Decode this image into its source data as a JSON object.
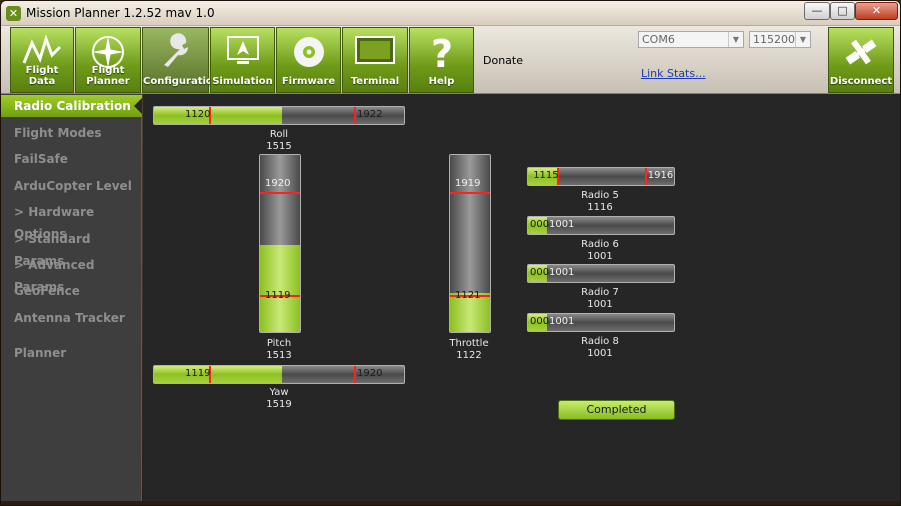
{
  "window": {
    "title": "Mission Planner 1.2.52 mav 1.0"
  },
  "toolbar": {
    "buttons": [
      {
        "label": "Flight Data",
        "icon": "flight-data-icon"
      },
      {
        "label": "Flight Planner",
        "icon": "compass-icon"
      },
      {
        "label": "Configuration",
        "icon": "wrench-icon"
      },
      {
        "label": "Simulation",
        "icon": "simulation-icon"
      },
      {
        "label": "Firmware",
        "icon": "disc-icon"
      },
      {
        "label": "Terminal",
        "icon": "terminal-icon"
      },
      {
        "label": "Help",
        "icon": "question-icon"
      }
    ],
    "donate": "Donate",
    "port": "COM6",
    "baud": "115200",
    "link_stats": "Link Stats...",
    "disconnect": "Disconnect",
    "active_index": 2
  },
  "sidebar": {
    "items": [
      {
        "label": "Radio Calibration",
        "active": true
      },
      {
        "label": "Flight Modes"
      },
      {
        "label": "FailSafe"
      },
      {
        "label": "ArduCopter Level"
      },
      {
        "label": "> Hardware Options"
      },
      {
        "label": "> Standard Params"
      },
      {
        "label": "> Advanced Params"
      },
      {
        "label": "GeoFence"
      },
      {
        "label": "Antenna Tracker"
      },
      {
        "label": "Planner"
      }
    ]
  },
  "channels": {
    "roll": {
      "name": "Roll",
      "value": "1515",
      "min": "1120",
      "max": "1922",
      "fill": 0.51,
      "min_pos": 0.22,
      "max_pos": 0.8
    },
    "pitch": {
      "name": "Pitch",
      "value": "1513",
      "min": "1119",
      "max": "1920",
      "fill": 0.49,
      "min_pos": 0.21,
      "max_pos": 0.79
    },
    "throttle": {
      "name": "Throttle",
      "value": "1122",
      "min": "1121",
      "max": "1919",
      "fill": 0.22,
      "min_pos": 0.21,
      "max_pos": 0.79
    },
    "yaw": {
      "name": "Yaw",
      "value": "1519",
      "min": "1119",
      "max": "1920",
      "fill": 0.51,
      "min_pos": 0.22,
      "max_pos": 0.8
    },
    "radio5": {
      "name": "Radio 5",
      "value": "1116",
      "min": "1115",
      "max": "1916",
      "fill": 0.2,
      "min_pos": 0.2,
      "max_pos": 0.8
    },
    "radio6": {
      "name": "Radio 6",
      "value": "1001",
      "min": "000",
      "max": "1001",
      "fill": 0.13,
      "min_pos": 0.13,
      "max_pos": 0.13
    },
    "radio7": {
      "name": "Radio 7",
      "value": "1001",
      "min": "000",
      "max": "1001",
      "fill": 0.13,
      "min_pos": 0.13,
      "max_pos": 0.13
    },
    "radio8": {
      "name": "Radio 8",
      "value": "1001",
      "min": "000",
      "max": "1001",
      "fill": 0.13,
      "min_pos": 0.13,
      "max_pos": 0.13
    }
  },
  "completed_button": "Completed",
  "colors": {
    "accent": "#8cc020",
    "marker": "#ff2020",
    "panel": "#262626",
    "sidebar": "#3e3e3e"
  }
}
